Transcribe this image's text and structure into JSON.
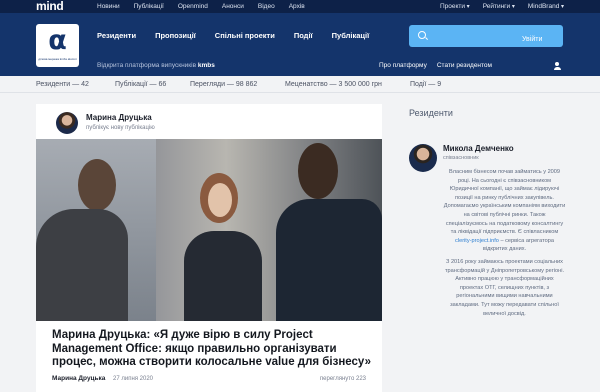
{
  "topbar": {
    "logo": "mind",
    "nav_left": [
      "Новини",
      "Публікації",
      "Openmind",
      "Анонси",
      "Відео",
      "Архів"
    ],
    "nav_right": [
      "Проекти",
      "Рейтинги",
      "MindBrand"
    ]
  },
  "header": {
    "brand_glyph": "α",
    "brand_caption": "ділова мережа kmbs alumni",
    "nav": [
      "Резиденти",
      "Пропозиції",
      "Спільні проекти",
      "Події",
      "Публікації"
    ],
    "subtitle_prefix": "Відкрита платформа випускників",
    "subtitle_brand": "kmbs",
    "sublinks": [
      "Про платформу",
      "Стати резидентом"
    ],
    "login": "Увійти",
    "search_placeholder": ""
  },
  "stats": [
    {
      "label": "Резиденти — 42"
    },
    {
      "label": "Публікації — 66"
    },
    {
      "label": "Перегляди — 98 862"
    },
    {
      "label": "Меценатство — 3 500 000 грн"
    },
    {
      "label": "Події — 9"
    }
  ],
  "card": {
    "author_name": "Марина Друцька",
    "author_action": "публікує нову публікацію",
    "title": "Марина Друцька: «Я дуже вірю в силу Project Management Office: якщо правильно організувати процес, можна створити колосальне value для бізнесу»",
    "footer_author": "Марина Друцька",
    "date": "27 липня 2020",
    "views": "переглянуто 223"
  },
  "sidebar": {
    "title": "Резиденти",
    "resident": {
      "name": "Микола Демченко",
      "role": "співзасновник",
      "bio_1": "Власним бізнесом почав займатись у 2009 році. На сьогодні є співзасновником Юридичної компанії, що займає лідируючі позиції на ринку публічних закупівель. Допомагаємо українським компаніям виходити на світові публічні ринки. Також спеціалізуємось на податковому консалтингу та ліквідації підприємств. Є співласником",
      "bio_link": "clerity-project.info",
      "bio_1_tail": "– сервіса агрегатора відкритих даних.",
      "bio_2": "З 2016 року займаюсь проектами соціальних трансформацій у Дніпропетровському регіоні. Активно працюю у трансформаційних проектах ОТГ, селищних пунктів, з регіональними вищими навчальними закладами. Тут можу передавати спільної величної досвід."
    }
  },
  "colors": {
    "topbar": "#0d2148",
    "header": "#14346b",
    "search": "#5bb4f4",
    "link": "#2f7fd0"
  }
}
